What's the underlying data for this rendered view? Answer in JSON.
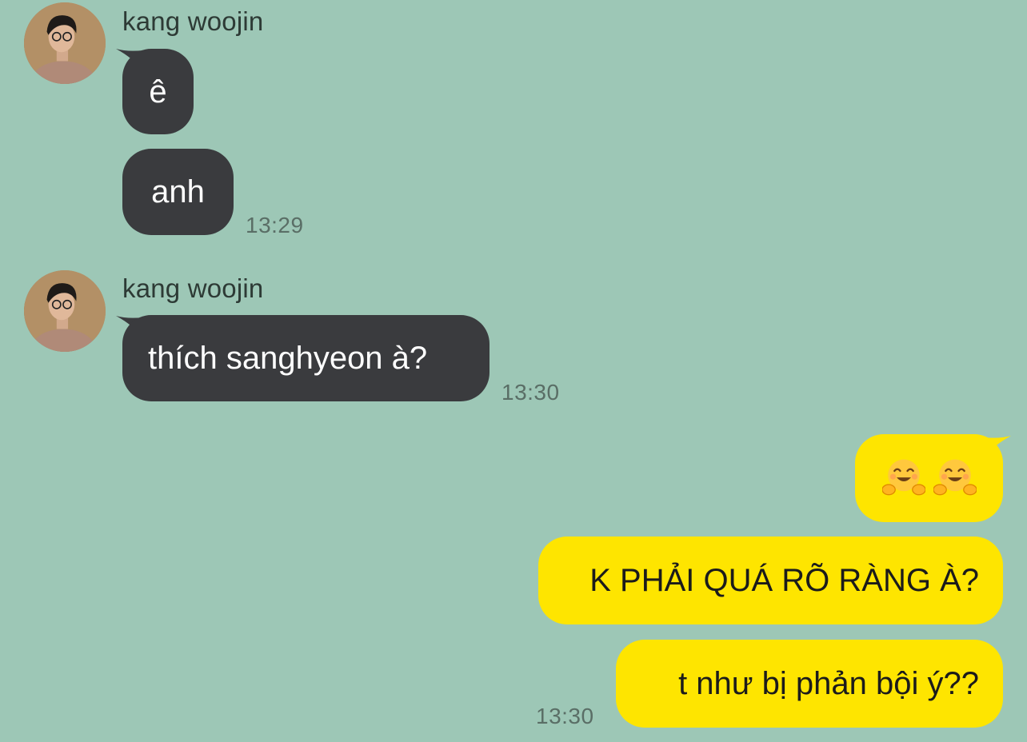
{
  "chat": {
    "colors": {
      "background": "#9dc7b6",
      "incoming_bubble": "#3a3b3e",
      "outgoing_bubble": "#fee500"
    },
    "groups": [
      {
        "sender": "kang woojin",
        "avatar": "profile-photo",
        "messages": [
          "ê",
          "anh"
        ],
        "time": "13:29"
      },
      {
        "sender": "kang woojin",
        "avatar": "profile-photo",
        "messages": [
          "thích sanghyeon à?"
        ],
        "time": "13:30"
      }
    ],
    "outgoing": {
      "emoji_message": [
        "hugging-face-emoji",
        "hugging-face-emoji"
      ],
      "messages": [
        "K PHẢI QUÁ RÕ RÀNG À?",
        "t như bị phản bội ý??"
      ],
      "time": "13:30"
    }
  }
}
